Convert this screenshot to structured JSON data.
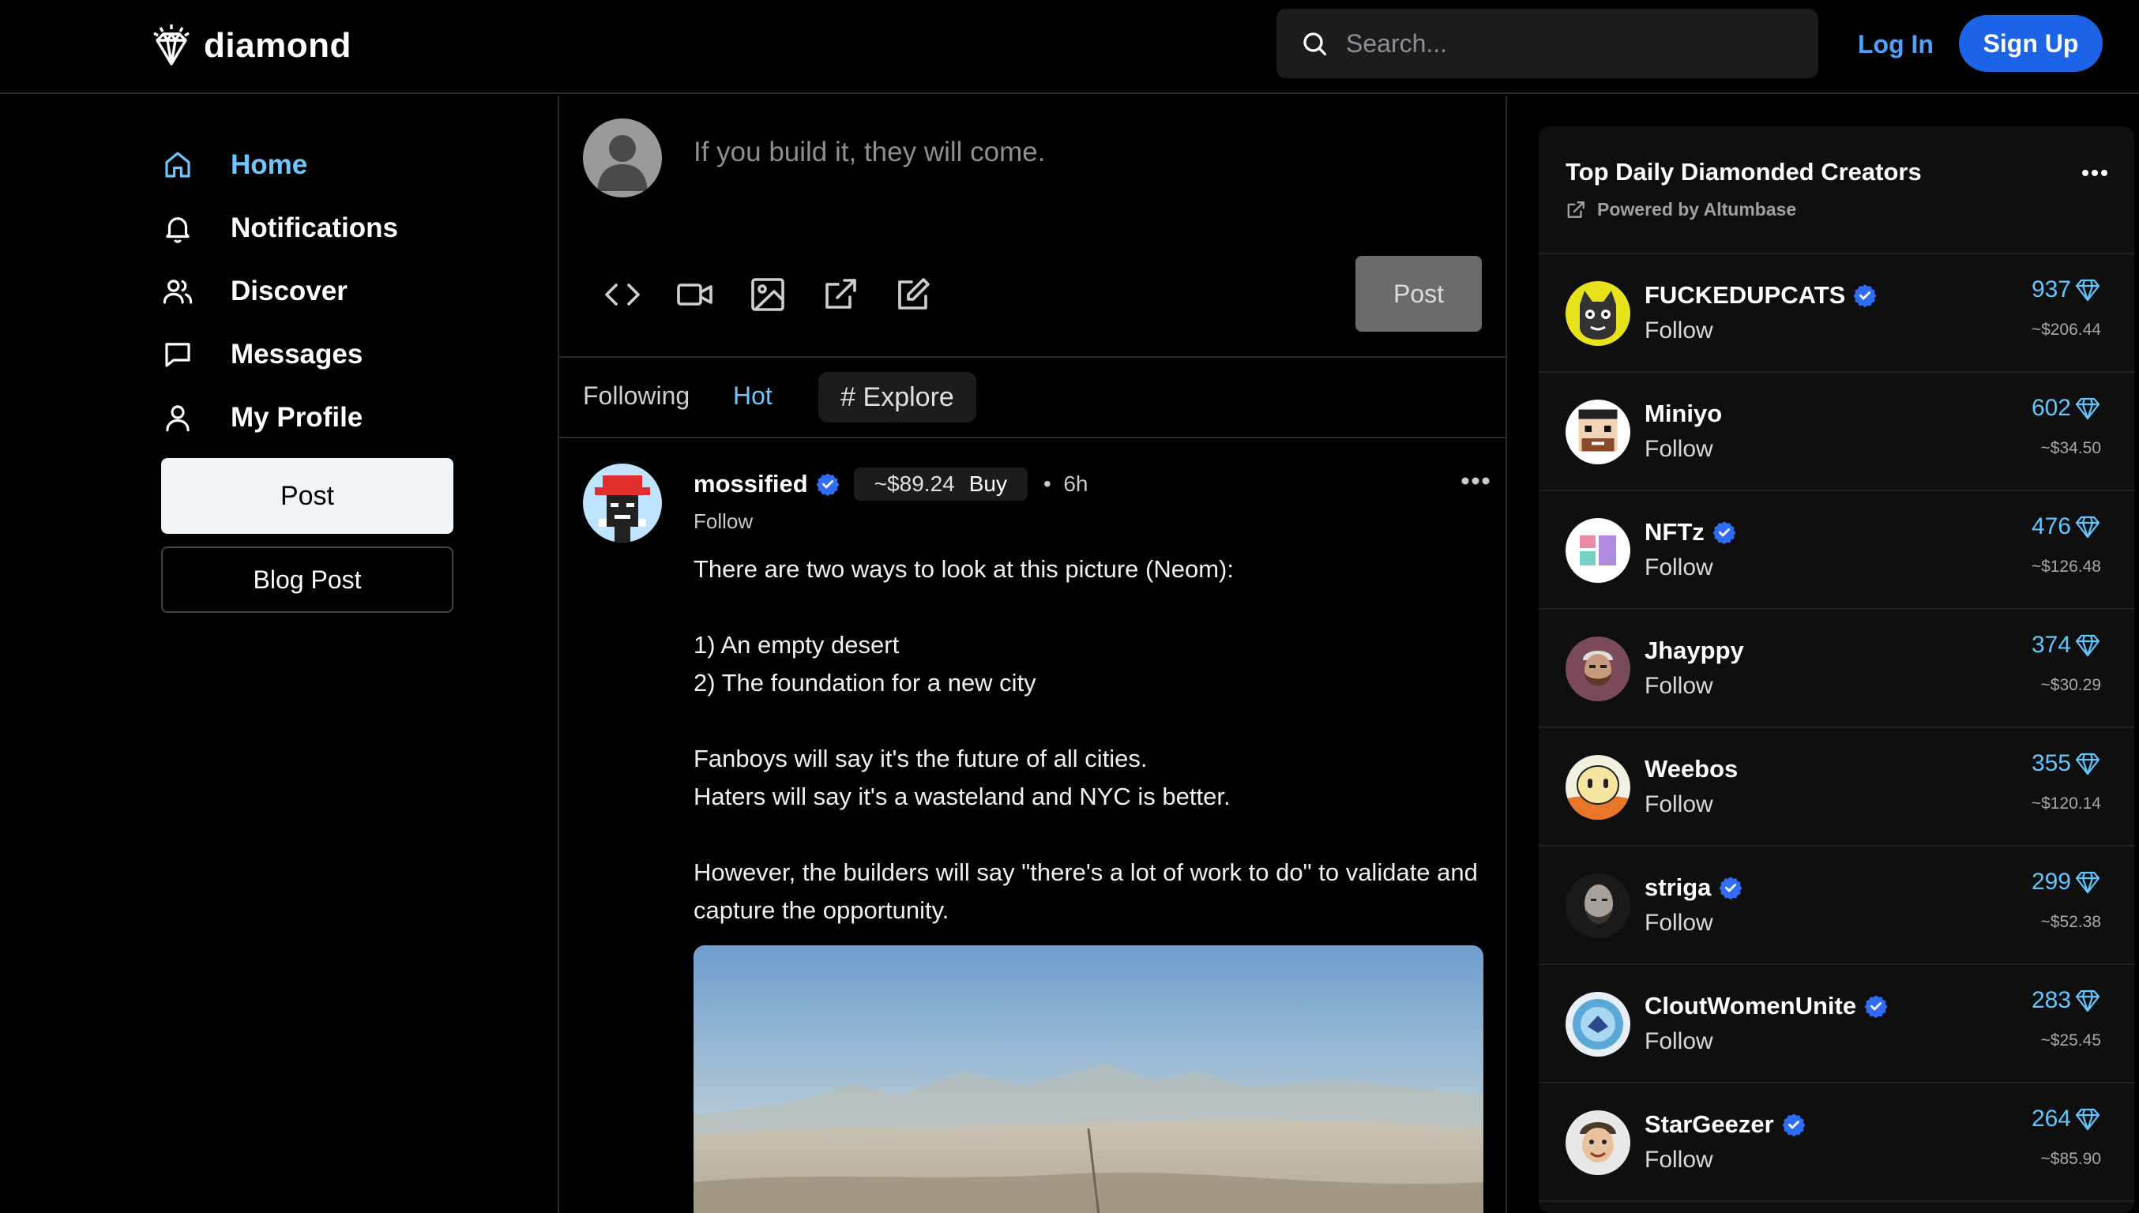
{
  "header": {
    "logo_text": "diamond",
    "search_placeholder": "Search...",
    "login_label": "Log In",
    "signup_label": "Sign Up"
  },
  "sidebar": {
    "items": [
      {
        "label": "Home",
        "icon": "home-icon",
        "active": true
      },
      {
        "label": "Notifications",
        "icon": "bell-icon"
      },
      {
        "label": "Discover",
        "icon": "users-icon"
      },
      {
        "label": "Messages",
        "icon": "message-icon"
      },
      {
        "label": "My Profile",
        "icon": "user-icon"
      }
    ],
    "post_label": "Post",
    "blog_post_label": "Blog Post"
  },
  "composer": {
    "placeholder": "If you build it, they will come.",
    "post_label": "Post",
    "tools": [
      "code-icon",
      "video-icon",
      "image-icon",
      "external-link-icon",
      "edit-icon"
    ]
  },
  "tabs": {
    "following": "Following",
    "hot": "Hot",
    "explore": "# Explore"
  },
  "post": {
    "author": "mossified",
    "price": "~$89.24",
    "buy": "Buy",
    "time": "6h",
    "follow": "Follow",
    "lines": [
      "There are two ways to look at this picture (Neom):",
      "",
      "1) An empty desert",
      "2) The foundation for a new city",
      "",
      "Fanboys will say it's the future of all cities.",
      "Haters will say it's a wasteland and NYC is better.",
      "",
      "However, the builders will say \"there's a lot of work to do\" to validate and capture the opportunity."
    ]
  },
  "creators_panel": {
    "title": "Top Daily Diamonded Creators",
    "powered_by": "Powered by Altumbase",
    "follow_label": "Follow",
    "accent_color": "#62c6ff",
    "creators": [
      {
        "name": "FUCKEDUPCATS",
        "verified": true,
        "diamonds": "937",
        "usd": "~$206.44"
      },
      {
        "name": "Miniyo",
        "verified": false,
        "diamonds": "602",
        "usd": "~$34.50"
      },
      {
        "name": "NFTz",
        "verified": true,
        "diamonds": "476",
        "usd": "~$126.48"
      },
      {
        "name": "Jhayppy",
        "verified": false,
        "diamonds": "374",
        "usd": "~$30.29"
      },
      {
        "name": "Weebos",
        "verified": false,
        "diamonds": "355",
        "usd": "~$120.14"
      },
      {
        "name": "striga",
        "verified": true,
        "diamonds": "299",
        "usd": "~$52.38"
      },
      {
        "name": "CloutWomenUnite",
        "verified": true,
        "diamonds": "283",
        "usd": "~$25.45"
      },
      {
        "name": "StarGeezer",
        "verified": true,
        "diamonds": "264",
        "usd": "~$85.90"
      }
    ]
  }
}
